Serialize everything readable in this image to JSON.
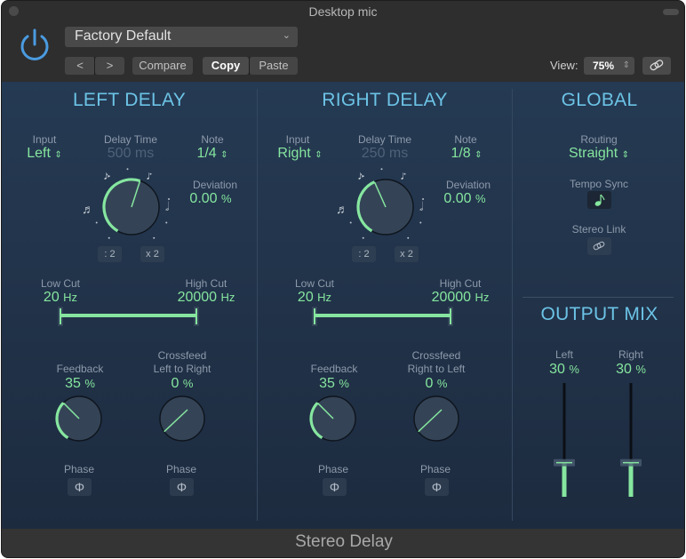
{
  "window": {
    "title": "Desktop mic"
  },
  "header": {
    "preset": "Factory Default",
    "prev_label": "<",
    "next_label": ">",
    "compare_label": "Compare",
    "copy_label": "Copy",
    "paste_label": "Paste",
    "view_label": "View:",
    "view_value": "75%",
    "icons": {
      "power": "power-icon",
      "link": "link-icon",
      "chevron": "chevron-down-icon",
      "stepper": "up-down-stepper-icon"
    }
  },
  "colors": {
    "accent_green": "#86e69f",
    "section_title_blue": "#6cc3e6",
    "power_blue": "#4a9be0",
    "panel_bg": "#253a53"
  },
  "left_delay": {
    "title": "LEFT DELAY",
    "input_label": "Input",
    "input_value": "Left",
    "delay_time_label": "Delay Time",
    "delay_time_value": "500 ms",
    "note_label": "Note",
    "note_value": "1/4",
    "deviation_label": "Deviation",
    "deviation_value": "0.00",
    "deviation_unit": "%",
    "halve_label": ": 2",
    "double_label": "x 2",
    "low_cut_label": "Low Cut",
    "low_cut_value": "20",
    "low_cut_unit": "Hz",
    "high_cut_label": "High Cut",
    "high_cut_value": "20000",
    "high_cut_unit": "Hz",
    "feedback_label": "Feedback",
    "feedback_value": "35",
    "feedback_unit": "%",
    "feedback_fraction": 0.35,
    "crossfeed_label_1": "Crossfeed",
    "crossfeed_label_2": "Left to Right",
    "crossfeed_value": "0",
    "crossfeed_unit": "%",
    "crossfeed_fraction": 0.0,
    "delay_knob_fraction": 0.56,
    "phase_label_1": "Phase",
    "phase_label_2": "Phase",
    "phase_symbol": "Φ"
  },
  "right_delay": {
    "title": "RIGHT DELAY",
    "input_label": "Input",
    "input_value": "Right",
    "delay_time_label": "Delay Time",
    "delay_time_value": "250 ms",
    "note_label": "Note",
    "note_value": "1/8",
    "deviation_label": "Deviation",
    "deviation_value": "0.00",
    "deviation_unit": "%",
    "halve_label": ": 2",
    "double_label": "x 2",
    "low_cut_label": "Low Cut",
    "low_cut_value": "20",
    "low_cut_unit": "Hz",
    "high_cut_label": "High Cut",
    "high_cut_value": "20000",
    "high_cut_unit": "Hz",
    "feedback_label": "Feedback",
    "feedback_value": "35",
    "feedback_unit": "%",
    "feedback_fraction": 0.35,
    "crossfeed_label_1": "Crossfeed",
    "crossfeed_label_2": "Right to Left",
    "crossfeed_value": "0",
    "crossfeed_unit": "%",
    "crossfeed_fraction": 0.0,
    "delay_knob_fraction": 0.42,
    "phase_label_1": "Phase",
    "phase_label_2": "Phase",
    "phase_symbol": "Φ"
  },
  "global": {
    "title": "GLOBAL",
    "routing_label": "Routing",
    "routing_value": "Straight",
    "tempo_sync_label": "Tempo Sync",
    "tempo_sync_on": true,
    "stereo_link_label": "Stereo Link",
    "stereo_link_on": false
  },
  "output_mix": {
    "title": "OUTPUT MIX",
    "left_label": "Left",
    "left_value": "30",
    "left_unit": "%",
    "left_fraction": 0.3,
    "right_label": "Right",
    "right_value": "30",
    "right_unit": "%",
    "right_fraction": 0.3
  },
  "footer": {
    "plugin_name": "Stereo Delay"
  }
}
